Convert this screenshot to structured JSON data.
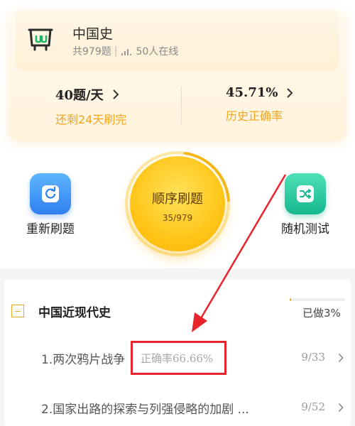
{
  "subject": {
    "title": "中国史",
    "count_text": "共979题",
    "online_text": "50人在线"
  },
  "stats": {
    "daily": {
      "value": "40题/天",
      "label": "还剩24天刷完"
    },
    "accuracy": {
      "value": "45.71%",
      "label": "历史正确率"
    }
  },
  "actions": {
    "reset": {
      "label": "重新刷题",
      "icon": "refresh-icon"
    },
    "sequential": {
      "label": "顺序刷题",
      "progress": "35/979",
      "progress_fraction": 0.0358
    },
    "random": {
      "label": "随机测试",
      "icon": "shuffle-icon"
    }
  },
  "chapter": {
    "title": "中国近现代史",
    "done_text": "已做3%",
    "done_fraction": 0.03,
    "sections": [
      {
        "title": "1.两次鸦片战争",
        "accuracy": "正确率66.66%",
        "count": "9/33"
      },
      {
        "title": "2.国家出路的探索与列强侵略的加剧 ...",
        "count": "9/52"
      }
    ]
  },
  "colors": {
    "accent": "#f3a41b",
    "annotation": "#e8242d",
    "reset_blue": "#2f7ff0",
    "random_green": "#17b890"
  }
}
